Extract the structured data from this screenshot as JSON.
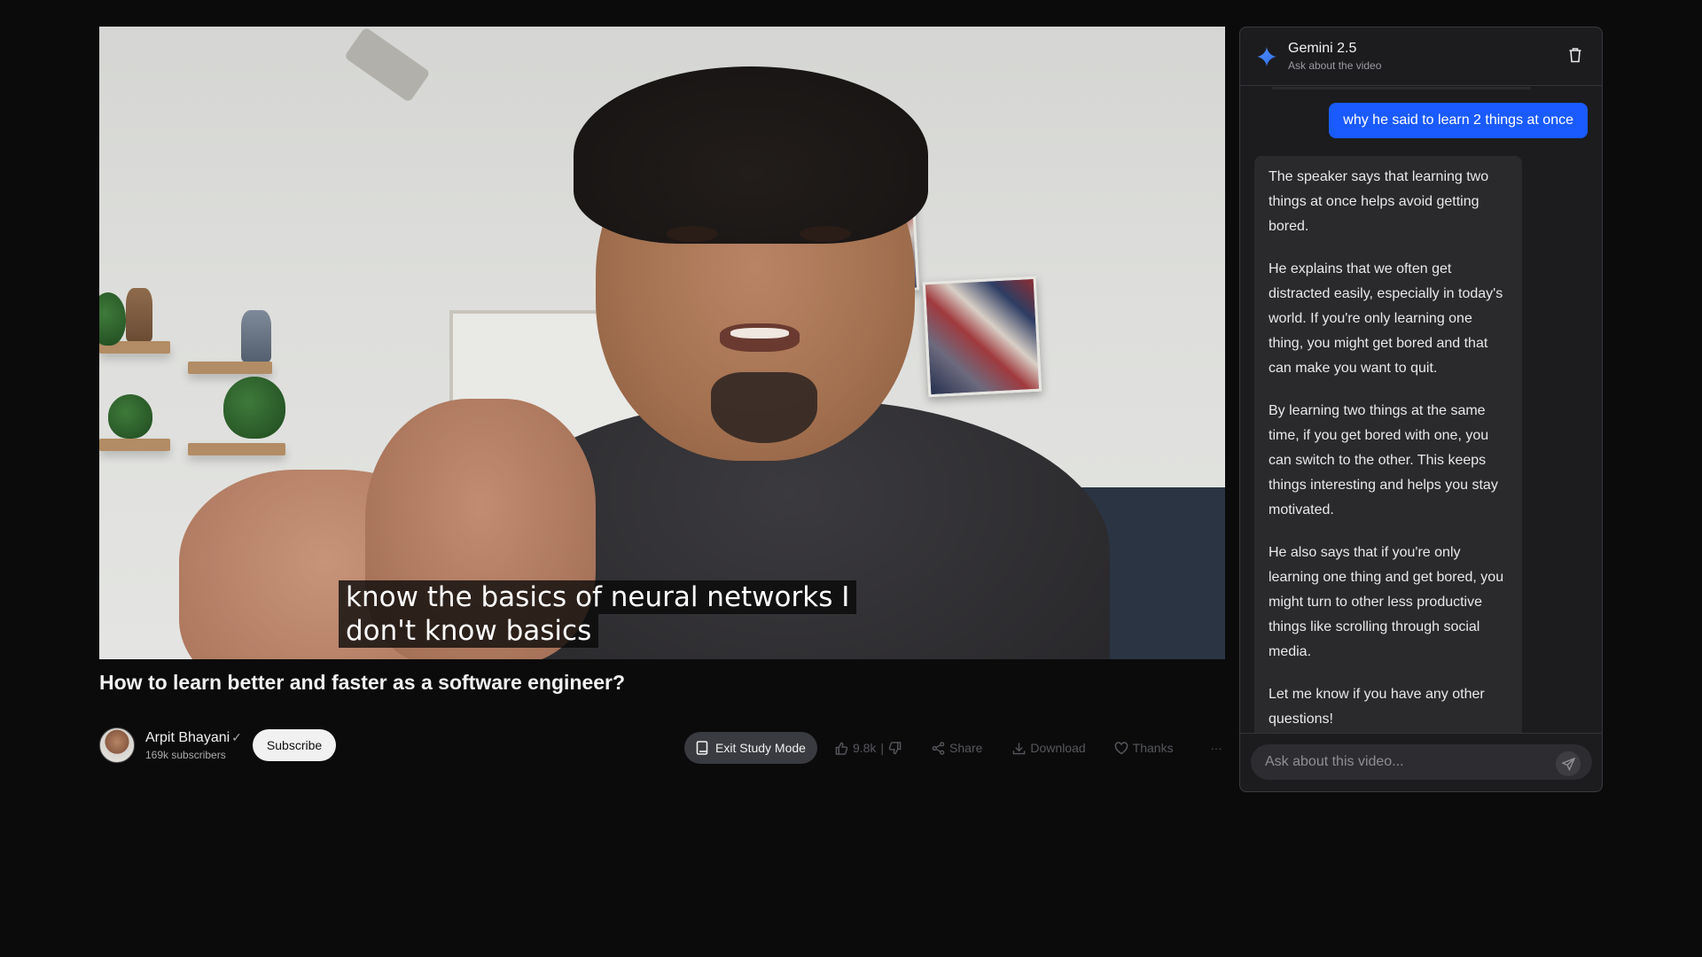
{
  "video": {
    "caption_line1": "know the basics of neural networks I",
    "caption_line2": "don't know basics"
  },
  "meta": {
    "title": "How to learn better and faster as a software engineer?",
    "channel_name": "Arpit Bhayani",
    "verified_glyph": "✓",
    "subscribers": "169k subscribers",
    "subscribe_label": "Subscribe"
  },
  "actions": {
    "study_mode": "Exit Study Mode",
    "likes": "9.8k",
    "like_divider": "|",
    "share": "Share",
    "download": "Download",
    "thanks": "Thanks",
    "more": "···"
  },
  "chat": {
    "title": "Gemini 2.5",
    "subtitle": "Ask about the video",
    "user_message": "why he said to learn 2 things at once",
    "bot_paragraphs": [
      "The speaker says that learning two things at once helps avoid getting bored.",
      "He explains that we often get distracted easily, especially in today's world. If you're only learning one thing, you might get bored and that can make you want to quit.",
      "By learning two things at the same time, if you get bored with one, you can switch to the other. This keeps things interesting and helps you stay motivated.",
      "He also says that if you're only learning one thing and get bored, you might turn to other less productive things like scrolling through social media.",
      "Let me know if you have any other questions!"
    ],
    "input_placeholder": "Ask about this video...",
    "accent_color": "#1a5bff"
  },
  "icons": [
    "sparkle-icon",
    "trash-icon",
    "book-icon",
    "thumbs-up-icon",
    "thumbs-down-icon",
    "share-icon",
    "download-icon",
    "heart-icon",
    "more-icon",
    "send-icon"
  ]
}
